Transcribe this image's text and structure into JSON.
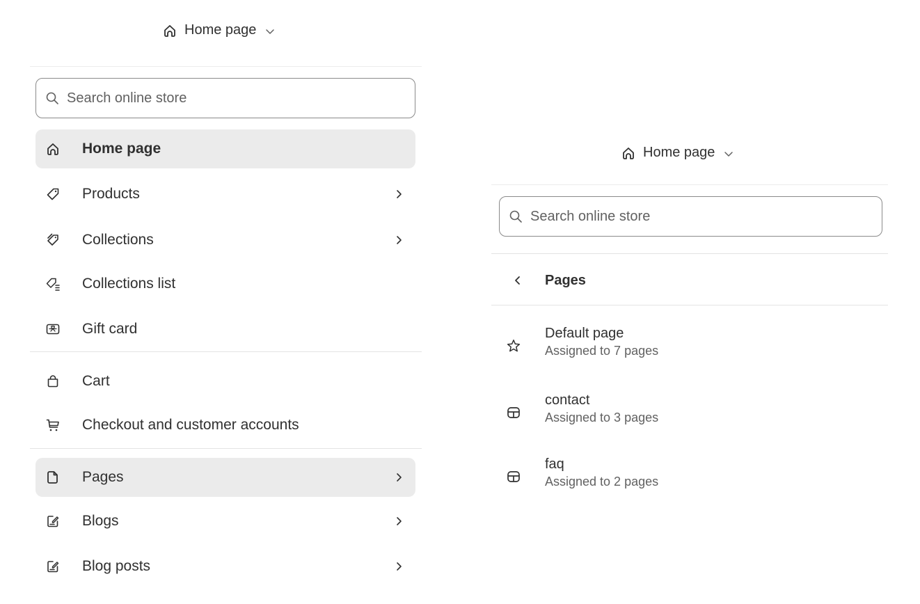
{
  "left_panel": {
    "page_selector": {
      "label": "Home page",
      "icon": "home-icon"
    },
    "search": {
      "placeholder": "Search online store",
      "value": ""
    },
    "items": [
      {
        "label": "Home page",
        "icon": "home-icon",
        "active": true,
        "has_chevron": false
      },
      {
        "label": "Products",
        "icon": "tag-icon",
        "has_chevron": true
      },
      {
        "label": "Collections",
        "icon": "tags-icon",
        "has_chevron": true
      },
      {
        "label": "Collections list",
        "icon": "tag-list-icon",
        "has_chevron": false
      },
      {
        "label": "Gift card",
        "icon": "gift-card-icon",
        "has_chevron": false
      },
      {
        "label": "Cart",
        "icon": "bag-icon",
        "has_chevron": false
      },
      {
        "label": "Checkout and customer accounts",
        "icon": "cart-icon",
        "has_chevron": false
      },
      {
        "label": "Pages",
        "icon": "page-icon",
        "hovered": true,
        "has_chevron": true
      },
      {
        "label": "Blogs",
        "icon": "blog-icon",
        "has_chevron": true
      },
      {
        "label": "Blog posts",
        "icon": "blog-post-icon",
        "has_chevron": true
      }
    ]
  },
  "right_panel": {
    "page_selector": {
      "label": "Home page",
      "icon": "home-icon"
    },
    "search": {
      "placeholder": "Search online store",
      "value": ""
    },
    "back": {
      "label": "Pages",
      "icon": "chevron-left-icon"
    },
    "templates": [
      {
        "name": "Default page",
        "assigned": "Assigned to 7 pages",
        "icon": "star-icon"
      },
      {
        "name": "contact",
        "assigned": "Assigned to 3 pages",
        "icon": "template-icon"
      },
      {
        "name": "faq",
        "assigned": "Assigned to 2 pages",
        "icon": "template-icon"
      }
    ]
  },
  "colors": {
    "text": "#303030",
    "subdued": "#616161",
    "active_bg": "#ebebeb",
    "border": "#8a8a8a",
    "divider": "#e3e3e3"
  }
}
